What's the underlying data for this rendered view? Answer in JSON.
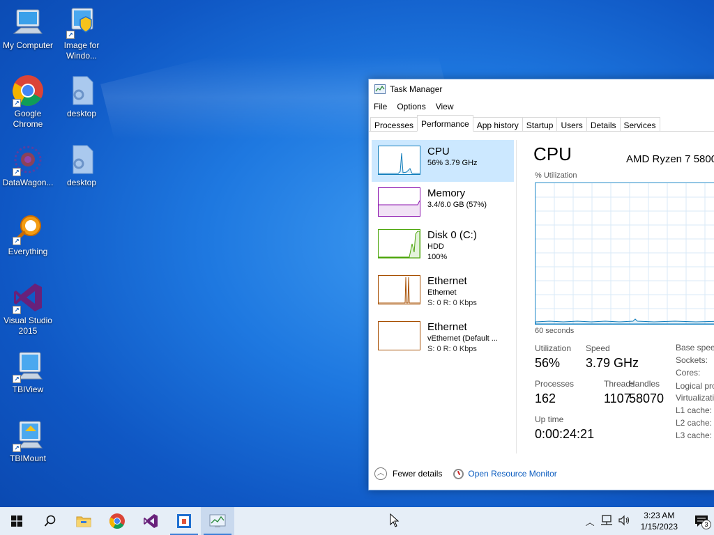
{
  "desktop": {
    "icons": [
      {
        "label": "My Computer"
      },
      {
        "label": "Image for Windo..."
      },
      {
        "label": "Google Chrome"
      },
      {
        "label": "desktop"
      },
      {
        "label": "DataWagon..."
      },
      {
        "label": "desktop"
      },
      {
        "label": "Everything"
      },
      {
        "label": "Visual Studio 2015"
      },
      {
        "label": "TBIView"
      },
      {
        "label": "TBIMount"
      }
    ]
  },
  "task_manager": {
    "title": "Task Manager",
    "menu": [
      "File",
      "Options",
      "View"
    ],
    "tabs": [
      "Processes",
      "Performance",
      "App history",
      "Startup",
      "Users",
      "Details",
      "Services"
    ],
    "active_tab": "Performance",
    "sidebar": [
      {
        "name": "CPU",
        "line1": "56%  3.79 GHz",
        "line2": "",
        "color": "#117dbb"
      },
      {
        "name": "Memory",
        "line1": "3.4/6.0 GB (57%)",
        "line2": "",
        "color": "#8b12ae"
      },
      {
        "name": "Disk 0 (C:)",
        "line1": "HDD",
        "line2": "100%",
        "color": "#4da60c"
      },
      {
        "name": "Ethernet",
        "line1": "Ethernet",
        "line2": "S: 0  R: 0 Kbps",
        "color": "#a74f01"
      },
      {
        "name": "Ethernet",
        "line1": "vEthernet (Default ...",
        "line2": "S: 0  R: 0 Kbps",
        "color": "#a74f01"
      }
    ],
    "detail": {
      "title": "CPU",
      "model": "AMD Ryzen 7 5800",
      "utilization_label": "% Utilization",
      "time_label": "60 seconds",
      "stats": {
        "utilization_label": "Utilization",
        "utilization": "56%",
        "speed_label": "Speed",
        "speed": "3.79 GHz",
        "processes_label": "Processes",
        "processes": "162",
        "threads_label": "Threads",
        "threads": "1107",
        "handles_label": "Handles",
        "handles": "58070",
        "uptime_label": "Up time",
        "uptime": "0:00:24:21"
      },
      "right_labels": [
        "Base speed",
        "Sockets:",
        "Cores:",
        "Logical pro",
        "Virtualizati",
        "L1 cache:",
        "L2 cache:",
        "L3 cache:"
      ]
    },
    "footer": {
      "fewer_details": "Fewer details",
      "resource_monitor": "Open Resource Monitor"
    }
  },
  "taskbar": {
    "clock_time": "3:23 AM",
    "clock_date": "1/15/2023",
    "notification_count": "3"
  }
}
